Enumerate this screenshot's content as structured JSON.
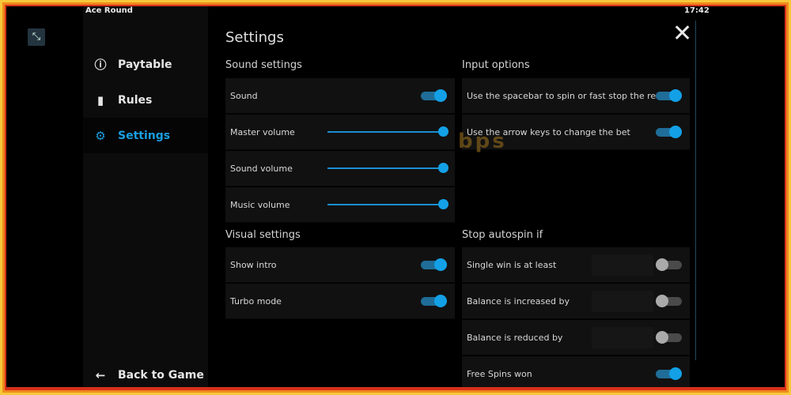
{
  "header": {
    "title": "Ace Round",
    "clock": "17:42"
  },
  "sidebar": {
    "items": [
      {
        "label": "Paytable",
        "icon": "info-icon",
        "active": false
      },
      {
        "label": "Rules",
        "icon": "book-icon",
        "active": false
      },
      {
        "label": "Settings",
        "icon": "gear-icon",
        "active": true
      }
    ],
    "back": "Back to Game"
  },
  "main": {
    "title": "Settings",
    "sound": {
      "heading": "Sound settings",
      "sound": {
        "label": "Sound",
        "on": true
      },
      "master": {
        "label": "Master volume",
        "value": 100
      },
      "sfx": {
        "label": "Sound volume",
        "value": 100
      },
      "music": {
        "label": "Music volume",
        "value": 100
      }
    },
    "visual": {
      "heading": "Visual settings",
      "intro": {
        "label": "Show intro",
        "on": true
      },
      "turbo": {
        "label": "Turbo mode",
        "on": true
      }
    },
    "input": {
      "heading": "Input options",
      "spacebar": {
        "label": "Use the spacebar to spin or fast stop the reels",
        "on": true
      },
      "arrows": {
        "label": "Use the arrow keys to change the bet",
        "on": true
      }
    },
    "autospin": {
      "heading": "Stop autospin if",
      "single": {
        "label": "Single win is at least",
        "on": false
      },
      "inc": {
        "label": "Balance is increased by",
        "on": false
      },
      "red": {
        "label": "Balance is reduced by",
        "on": false
      },
      "free": {
        "label": "Free Spins won",
        "on": true
      }
    }
  },
  "watermark": "bps",
  "colors": {
    "accent": "#13a0e6",
    "background": "#000000",
    "row": "#111111"
  }
}
